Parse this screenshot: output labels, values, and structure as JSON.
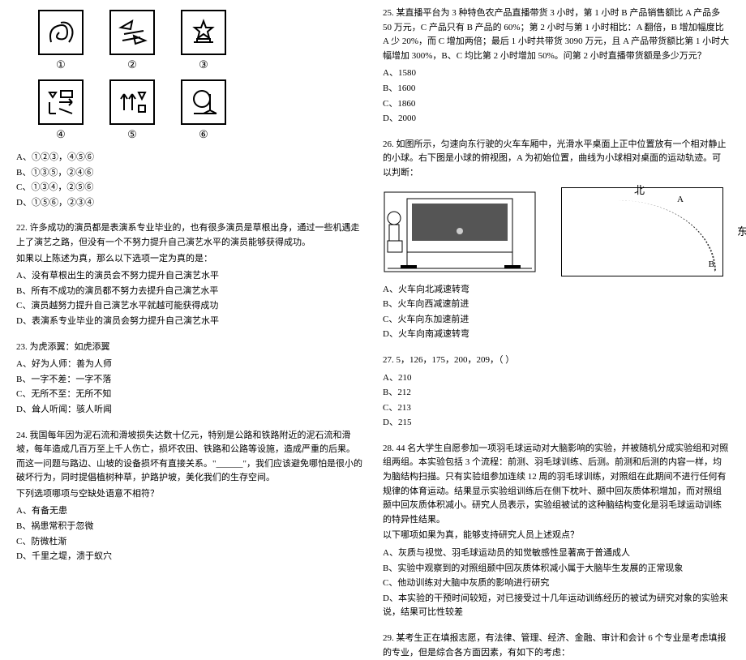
{
  "left": {
    "icons": [
      "①",
      "②",
      "③",
      "④",
      "⑤",
      "⑥"
    ],
    "q21opts": {
      "A": "A、①②③，④⑤⑥",
      "B": "B、①③⑤，②④⑥",
      "C": "C、①③④，②⑤⑥",
      "D": "D、①⑤⑥，②③④"
    },
    "q22": {
      "text": "22. 许多成功的演员都是表演系专业毕业的，也有很多演员是草根出身，通过一些机遇走上了演艺之路，但没有一个不努力提升自己演艺水平的演员能够获得成功。",
      "prem": "如果以上陈述为真，那么以下选项一定为真的是：",
      "A": "A、没有草根出生的演员会不努力提升自己演艺水平",
      "B": "B、所有不成功的演员都不努力去提升自己演艺水平",
      "C": "C、演员越努力提升自己演艺水平就越可能获得成功",
      "D": "D、表演系专业毕业的演员会努力提升自己演艺水平"
    },
    "q23": {
      "stem": "23. 为虎添翼：如虎添翼",
      "A": "A、好为人师：善为人师",
      "B": "B、一字不差：一字不落",
      "C": "C、无所不至：无所不知",
      "D": "D、耸人听闻：骇人听闻"
    },
    "q24": {
      "text": "24. 我国每年因为泥石流和滑坡损失达数十亿元，特别是公路和铁路附近的泥石流和滑坡，每年造成几百万至上千人伤亡，损坏农田、铁路和公路等设施，造成严重的后果。而这一问题与路边、山坡的设备损坏有直接关系。\"______\"，我们应该避免哪怕是很小的破坏行为，同时提倡植树种草，护路护坡，美化我们的生存空间。",
      "ask": "下列选项哪项与空缺处语意不相符？",
      "A": "A、有备无患",
      "B": "B、祸患常积于忽微",
      "C": "C、防微杜渐",
      "D": "D、千里之堤，溃于蚁穴"
    }
  },
  "right": {
    "q25": {
      "text": "25. 某直播平台为 3 种特色农产品直播带货 3 小时，第 1 小时 B 产品销售额比 A 产品多 50 万元，C 产品只有 B 产品的 60%；第 2 小时与第 1 小时相比：A 翻倍，B 增加幅度比 A 少 20%，而 C 增加两倍；最后 1 小时共带货 3090 万元，且 A 产品带货额比第 1 小时大幅增加 300%，B、C 均比第 2 小时增加 50%。问第 2 小时直播带货额是多少万元？",
      "A": "A、1580",
      "B": "B、1600",
      "C": "C、1860",
      "D": "D、2000"
    },
    "q26": {
      "text": "26. 如图所示，匀速向东行驶的火车车厢中，光滑水平桌面上正中位置放有一个相对静止的小球。右下图是小球的俯视图，A 为初始位置，曲线为小球相对桌面的运动轨迹。可以判断：",
      "north": "北",
      "east": "东",
      "labelA": "A",
      "labelB": "B",
      "optA": "A、火车向北减速转弯",
      "optB": "B、火车向西减速前进",
      "optC": "C、火车向东加速前进",
      "optD": "D、火车向南减速转弯"
    },
    "q27": {
      "stem": "27. 5，126，175，200，209，（    ）",
      "A": "A、210",
      "B": "B、212",
      "C": "C、213",
      "D": "D、215"
    },
    "q28": {
      "text": "28. 44 名大学生自愿参加一项羽毛球运动对大脑影响的实验，并被随机分成实验组和对照组两组。本实验包括 3 个流程：前测、羽毛球训练、后测。前测和后测的内容一样，均为脑结构扫描。只有实验组参加连续 12 周的羽毛球训练，对照组在此期间不进行任何有规律的体育运动。结果显示实验组训练后在侧下枕叶、颞中回灰质体积增加，而对照组颞中回灰质体积减小。研究人员表示，实验组被试的这种脑结构变化是羽毛球运动训练的特异性结果。",
      "ask": "以下哪项如果为真，能够支持研究人员上述观点？",
      "A": "A、灰质与视觉、羽毛球运动员的知觉敏感性显著高于普通成人",
      "B": "B、实验中观察到的对照组颞中回灰质体积减小属于大脑毕生发展的正常现象",
      "C": "C、他动训练对大脑中灰质的影响进行研究",
      "D": "D、本实验的干预时间较短，对已接受过十几年运动训练经历的被试为研究对象的实验来说，结果可比性较差"
    },
    "q29": {
      "text": "29. 某考生正在填报志愿，有法律、管理、经济、金融、审计和会计 6 个专业是考虑填报的专业，但是综合各方面因素，有如下的考虑："
    }
  }
}
